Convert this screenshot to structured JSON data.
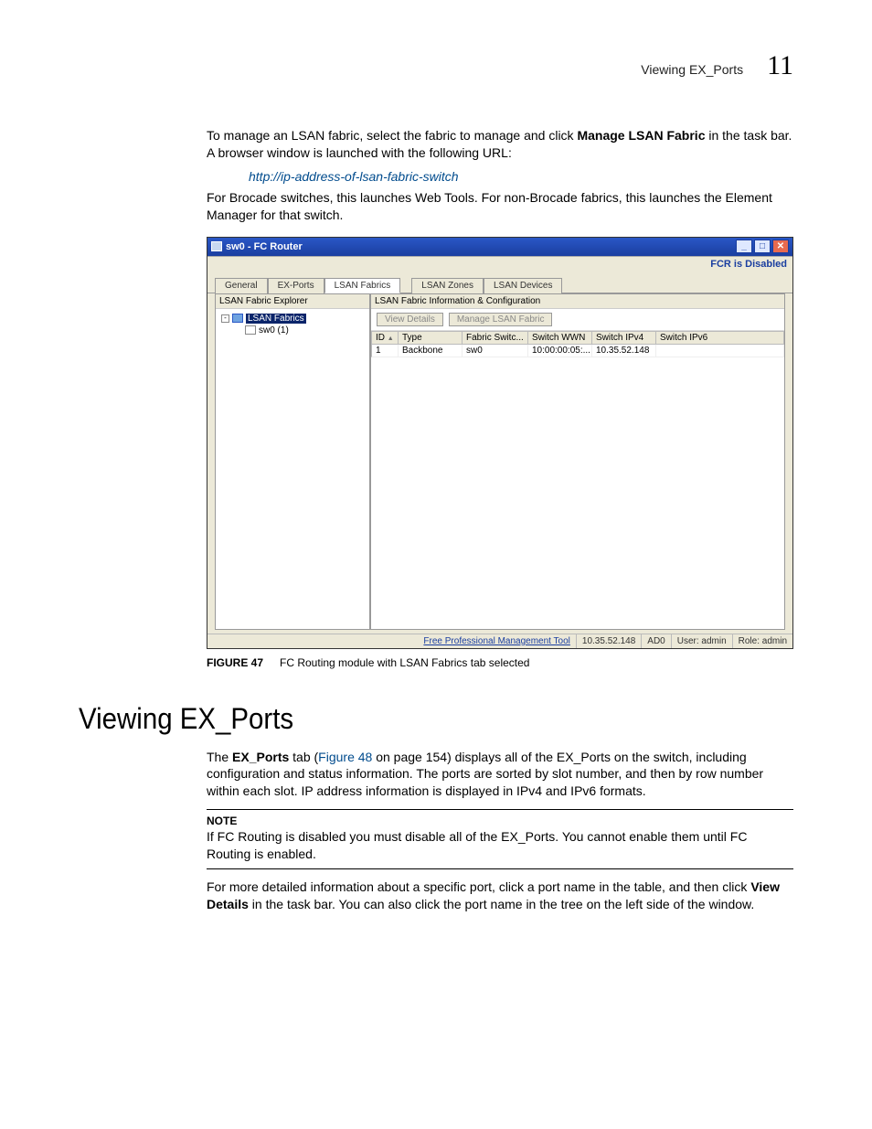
{
  "header": {
    "section": "Viewing EX_Ports",
    "page": "11"
  },
  "para1a": "To manage an LSAN fabric, select the fabric to manage and click ",
  "para1b": "Manage LSAN Fabric",
  "para1c": " in the task bar. A browser window is launched with the following URL:",
  "url_example": "http://ip-address-of-lsan-fabric-switch",
  "para2": "For Brocade switches, this launches Web Tools. For non-Brocade fabrics, this launches the Element Manager for that switch.",
  "window": {
    "title": "sw0 - FC Router",
    "status": "FCR is Disabled",
    "tabs": {
      "general": "General",
      "exports": "EX-Ports",
      "fabrics": "LSAN Fabrics",
      "zones": "LSAN Zones",
      "devices": "LSAN Devices"
    },
    "explorer_title": "LSAN Fabric Explorer",
    "tree": {
      "root": "LSAN Fabrics",
      "leaf": "sw0 (1)"
    },
    "detail_title": "LSAN Fabric Information & Configuration",
    "buttons": {
      "view": "View Details",
      "manage": "Manage LSAN Fabric"
    },
    "columns": {
      "id": "ID",
      "type": "Type",
      "fabric_switch": "Fabric Switc...",
      "wwn": "Switch WWN",
      "ipv4": "Switch IPv4",
      "ipv6": "Switch IPv6"
    },
    "row": {
      "id": "1",
      "type": "Backbone",
      "fabric_switch": "sw0",
      "wwn": "10:00:00:05:...",
      "ipv4": "10.35.52.148",
      "ipv6": ""
    },
    "footer": {
      "link": "Free Professional Management Tool",
      "ip": "10.35.52.148",
      "ad": "AD0",
      "user": "User: admin",
      "role": "Role: admin"
    }
  },
  "figure": {
    "label": "FIGURE 47",
    "caption": "FC Routing module with LSAN Fabrics tab selected"
  },
  "heading": "Viewing EX_Ports",
  "para3a": "The ",
  "para3b": "EX_Ports",
  "para3c": " tab (",
  "para3d": "Figure 48",
  "para3e": " on page 154) displays all of the EX_Ports on the switch, including configuration and status information. The ports are sorted by slot number, and then by row number within each slot. IP address information is displayed in IPv4 and IPv6 formats.",
  "note": {
    "label": "NOTE",
    "text": "If FC Routing is disabled you must disable all of the EX_Ports. You cannot enable them until FC Routing is enabled."
  },
  "para4a": "For more detailed information about a specific port, click a port name in the table, and then click ",
  "para4b": "View Details",
  "para4c": " in the task bar. You can also click the port name in the tree on the left side of the window."
}
